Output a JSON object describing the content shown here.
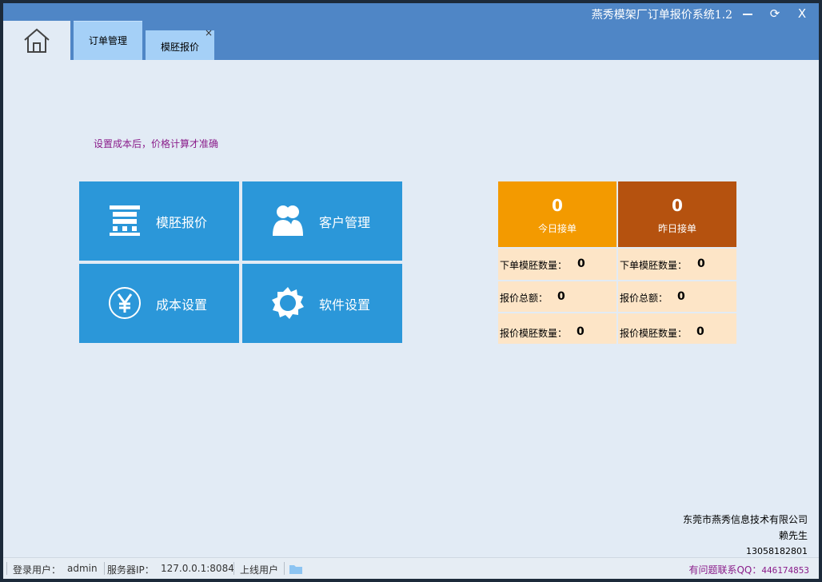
{
  "window": {
    "title": "燕秀模架厂订单报价系统1.2",
    "controls": {
      "minimize": "—",
      "restore": "⟳",
      "close": "X"
    }
  },
  "tabs": [
    {
      "label": "订单管理",
      "active": true
    },
    {
      "label": "模胚报价",
      "active": false,
      "close": "×"
    }
  ],
  "notice": "设置成本后，价格计算才准确",
  "tiles": [
    {
      "label": "模胚报价",
      "icon": "mold-base-icon"
    },
    {
      "label": "客户管理",
      "icon": "users-icon"
    },
    {
      "label": "成本设置",
      "icon": "yen-icon"
    },
    {
      "label": "软件设置",
      "icon": "gear-icon"
    }
  ],
  "stats": {
    "today": {
      "count": "0",
      "caption": "今日接单",
      "order_qty_label": "下单模胚数量：",
      "order_qty": "0",
      "quote_total_label": "报价总额：",
      "quote_total": "0",
      "quote_qty_label": "报价模胚数量：",
      "quote_qty": "0"
    },
    "yesterday": {
      "count": "0",
      "caption": "昨日接单",
      "order_qty_label": "下单模胚数量：",
      "order_qty": "0",
      "quote_total_label": "报价总额：",
      "quote_total": "0",
      "quote_qty_label": "报价模胚数量：",
      "quote_qty": "0"
    }
  },
  "company": {
    "name": "东莞市燕秀信息技术有限公司",
    "contact": "赖先生",
    "phone": "13058182801"
  },
  "statusbar": {
    "user_label": "登录用户：",
    "user": "admin",
    "server_label": "服务器IP：",
    "server_ip": "127.0.0.1:8084",
    "online_label": "上线用户",
    "qq_label": "有问题联系QQ：",
    "qq": "446174853"
  },
  "colors": {
    "titlebar": "#4f86c6",
    "tab": "#a5d0f7",
    "tile": "#2b97d9",
    "today": "#f39a00",
    "yesterday": "#b5520f",
    "stat_cell": "#fde5c7",
    "notice": "#8a1c8a"
  }
}
